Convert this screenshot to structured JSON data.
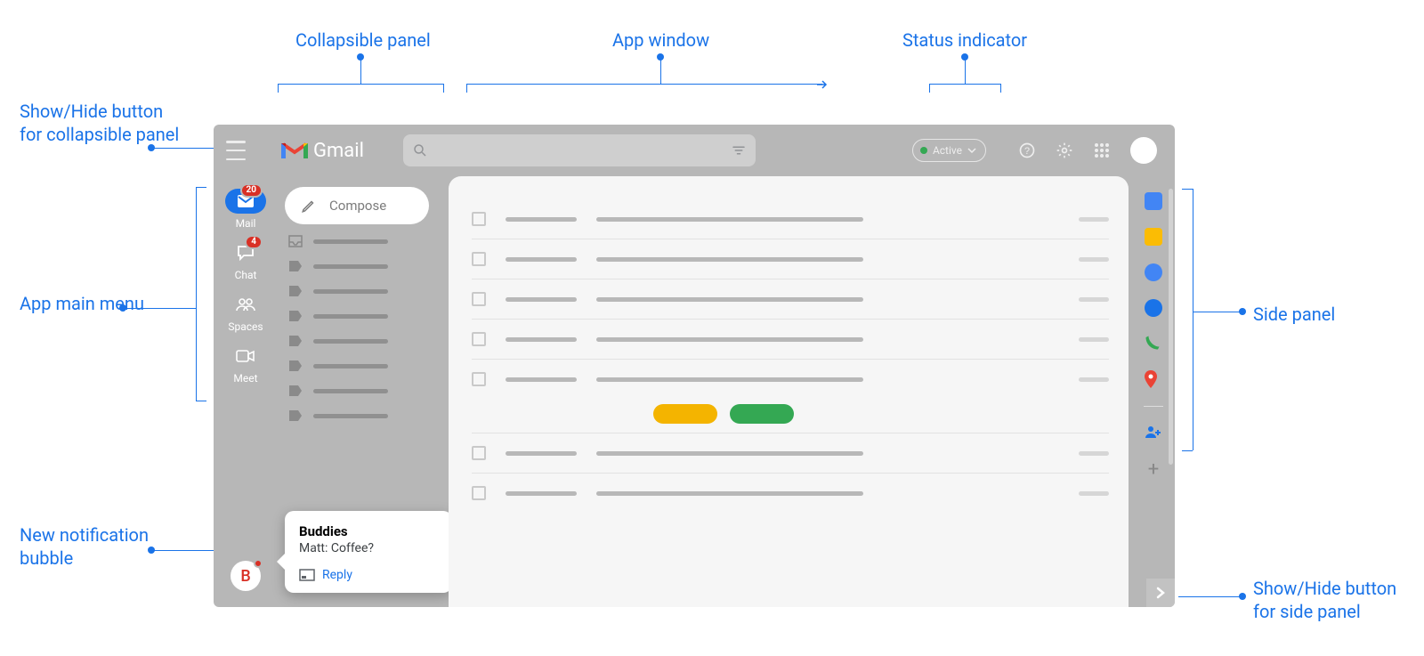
{
  "annotations": {
    "hamburger": "Show/Hide button for collapsible panel",
    "collapsible": "Collapsible panel",
    "appwindow": "App window",
    "status": "Status indicator",
    "leftrail": "App main menu",
    "notif": "New notification bubble",
    "sidepanel": "Side panel",
    "sidetoggle": "Show/Hide button for side panel"
  },
  "header": {
    "product": "Gmail",
    "search_placeholder": "",
    "status_label": "Active"
  },
  "rail": {
    "items": [
      {
        "id": "mail",
        "label": "Mail",
        "badge": "20",
        "active": true
      },
      {
        "id": "chat",
        "label": "Chat",
        "badge": "4",
        "active": false
      },
      {
        "id": "spaces",
        "label": "Spaces",
        "badge": "",
        "active": false
      },
      {
        "id": "meet",
        "label": "Meet",
        "badge": "",
        "active": false
      }
    ],
    "notif_avatar_initial": "B"
  },
  "compose_label": "Compose",
  "notification": {
    "title": "Buddies",
    "body": "Matt: Coffee?",
    "reply_label": "Reply"
  },
  "sidepanel_icons": [
    "calendar",
    "keep",
    "tasks",
    "contacts",
    "voice",
    "maps"
  ]
}
